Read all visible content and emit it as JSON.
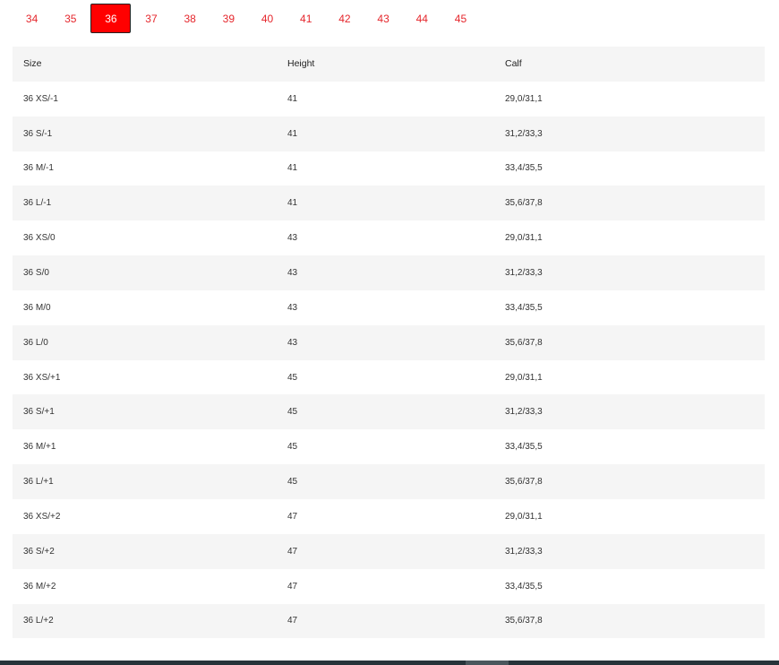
{
  "size_tabs": [
    "34",
    "35",
    "36",
    "37",
    "38",
    "39",
    "40",
    "41",
    "42",
    "43",
    "44",
    "45"
  ],
  "active_tab": "36",
  "table": {
    "headers": {
      "size": "Size",
      "height": "Height",
      "calf": "Calf"
    },
    "rows": [
      {
        "size": "36 XS/-1",
        "height": "41",
        "calf": "29,0/31,1"
      },
      {
        "size": "36 S/-1",
        "height": "41",
        "calf": "31,2/33,3"
      },
      {
        "size": "36 M/-1",
        "height": "41",
        "calf": "33,4/35,5"
      },
      {
        "size": "36 L/-1",
        "height": "41",
        "calf": "35,6/37,8"
      },
      {
        "size": "36 XS/0",
        "height": "43",
        "calf": "29,0/31,1"
      },
      {
        "size": "36 S/0",
        "height": "43",
        "calf": "31,2/33,3"
      },
      {
        "size": "36 M/0",
        "height": "43",
        "calf": "33,4/35,5"
      },
      {
        "size": "36 L/0",
        "height": "43",
        "calf": "35,6/37,8"
      },
      {
        "size": "36 XS/+1",
        "height": "45",
        "calf": "29,0/31,1"
      },
      {
        "size": "36 S/+1",
        "height": "45",
        "calf": "31,2/33,3"
      },
      {
        "size": "36 M/+1",
        "height": "45",
        "calf": "33,4/35,5"
      },
      {
        "size": "36 L/+1",
        "height": "45",
        "calf": "35,6/37,8"
      },
      {
        "size": "36 XS/+2",
        "height": "47",
        "calf": "29,0/31,1"
      },
      {
        "size": "36 S/+2",
        "height": "47",
        "calf": "31,2/33,3"
      },
      {
        "size": "36 M/+2",
        "height": "47",
        "calf": "33,4/35,5"
      },
      {
        "size": "36 L/+2",
        "height": "47",
        "calf": "35,6/37,8"
      }
    ]
  },
  "colors": {
    "accent": "#ff0000",
    "tab_text": "#e5262c",
    "row_shade": "#f5f5f5",
    "footer_bar": "#27343a"
  }
}
